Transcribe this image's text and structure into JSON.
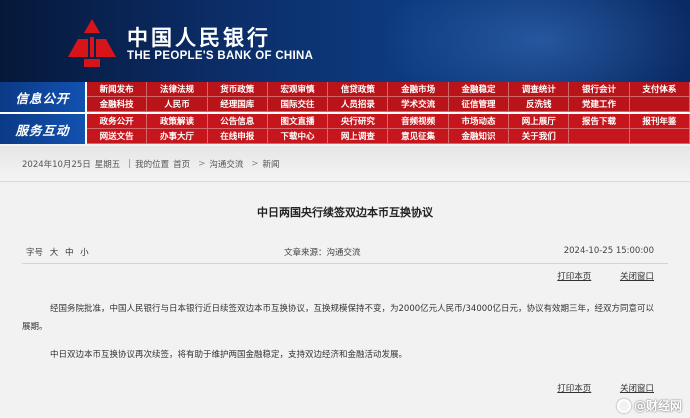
{
  "header": {
    "bank_name_cn": "中国人民银行",
    "bank_name_en": "THE PEOPLE'S BANK OF CHINA",
    "logo_icon": "pboc-logo-icon",
    "colors": {
      "banner": "#0c2f6b",
      "nav_red": "#b81419",
      "nav_label_blue": "#0b3a86"
    }
  },
  "nav": {
    "row1": {
      "label": "信息公开",
      "items": [
        "新闻发布",
        "法律法规",
        "货币政策",
        "宏观审慎",
        "信贷政策",
        "金融市场",
        "金融稳定",
        "调查统计",
        "银行会计",
        "支付体系",
        "金融科技",
        "人民币",
        "经理国库",
        "国际交往",
        "人员招录",
        "学术交流",
        "征信管理",
        "反洗钱",
        "党建工作",
        ""
      ]
    },
    "row2": {
      "label": "服务互动",
      "items": [
        "政务公开",
        "政策解读",
        "公告信息",
        "图文直播",
        "央行研究",
        "音频视频",
        "市场动态",
        "网上展厅",
        "报告下载",
        "报刊年鉴",
        "网送文告",
        "办事大厅",
        "在线申报",
        "下载中心",
        "网上调查",
        "意见征集",
        "金融知识",
        "关于我们",
        "",
        ""
      ]
    }
  },
  "breadcrumb": {
    "date": "2024年10月25日",
    "weekday": "星期五",
    "location_label": "我的位置",
    "items": [
      "首页",
      "沟通交流",
      "新闻"
    ]
  },
  "article": {
    "title": "中日两国央行续签双边本币互换协议",
    "font_size_label": "字号",
    "font_sizes": [
      "大",
      "中",
      "小"
    ],
    "source": "文章来源：沟通交流",
    "date": "2024-10-25 15:00:00",
    "print_label": "打印本页",
    "close_label": "关闭窗口",
    "paragraphs": [
      "经国务院批准，中国人民银行与日本银行近日续签双边本币互换协议，互换规模保持不变，为2000亿元人民币/34000亿日元，协议有效期三年，经双方同意可以展期。",
      "中日双边本币互换协议再次续签，将有助于维护两国金融稳定，支持双边经济和金融活动发展。"
    ]
  },
  "watermark": {
    "text": "@财经网",
    "icon": "weibo-icon"
  }
}
